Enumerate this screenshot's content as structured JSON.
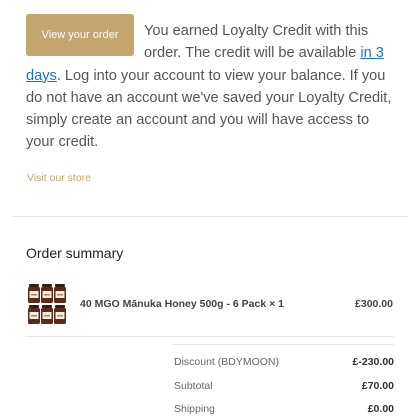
{
  "intro": {
    "button_label": "View your order",
    "text_before_link": "You earned Loyalty Credit with this order. The credit will be available ",
    "link_text": "in 3 days",
    "text_after_link": ". Log into your account to view your balance. If you do not have an account we've saved your Loyalty Credit, simply create an account and you will have access to your credit."
  },
  "store_link": "Visit our store",
  "order_summary": {
    "title": "Order summary",
    "items": [
      {
        "name": "40 MGO Mānuka Honey 500g - 6 Pack × 1",
        "price": "£300.00"
      }
    ],
    "totals": {
      "discount_label": "Discount (BDYMOON)",
      "discount_value": "£-230.00",
      "subtotal_label": "Subtotal",
      "subtotal_value": "£70.00",
      "shipping_label": "Shipping",
      "shipping_value": "£0.00"
    }
  },
  "colors": {
    "accent_gold": "#c4a56e",
    "link_blue": "#1a6fd1",
    "jar_amber": "#5b2a1a",
    "jar_label": "#f3ece2"
  }
}
